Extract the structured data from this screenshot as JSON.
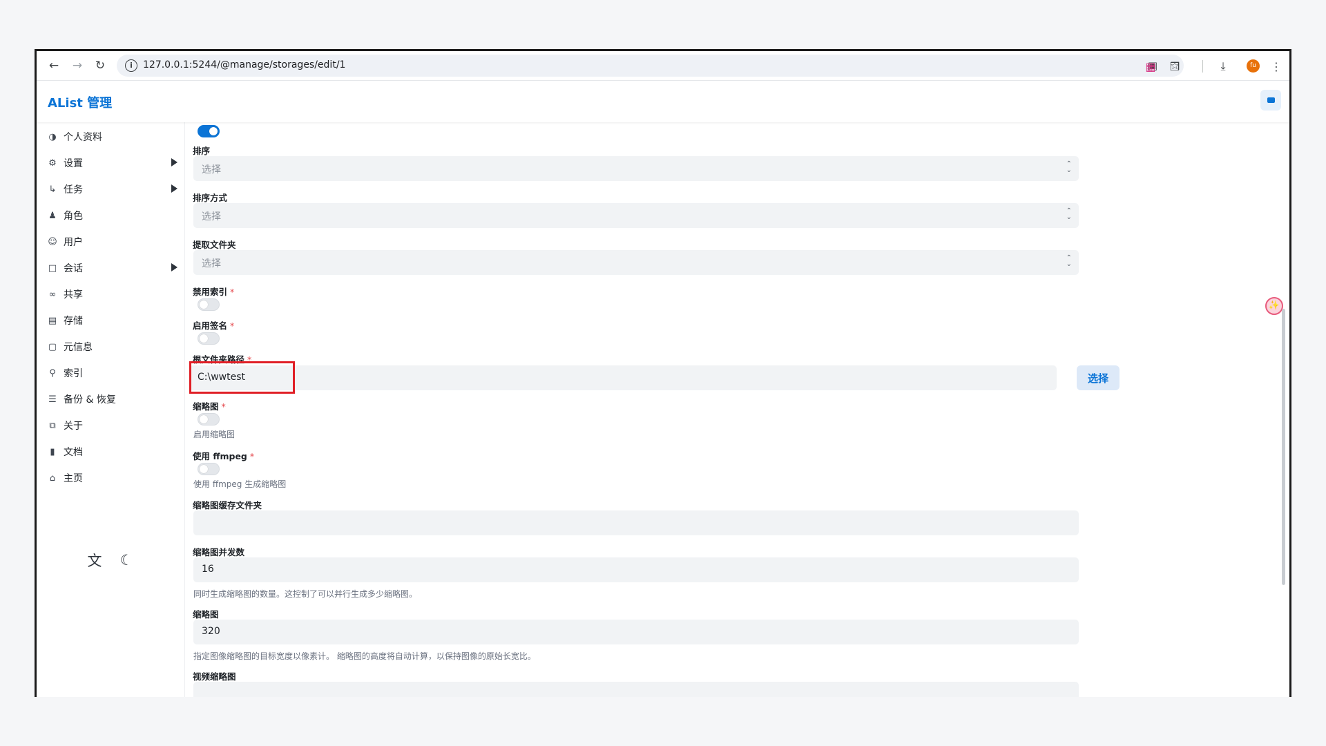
{
  "browser": {
    "url": "127.0.0.1:5244/@manage/storages/edit/1",
    "avatar_text": "fu"
  },
  "app": {
    "brand": "AList 管理"
  },
  "sidebar": {
    "items": [
      {
        "label": "个人资料",
        "icon": "globe-icon",
        "arrow": false
      },
      {
        "label": "设置",
        "icon": "gear-icon",
        "arrow": true
      },
      {
        "label": "任务",
        "icon": "task-flow-icon",
        "arrow": true
      },
      {
        "label": "角色",
        "icon": "role-icon",
        "arrow": false
      },
      {
        "label": "用户",
        "icon": "user-circle-icon",
        "arrow": false
      },
      {
        "label": "会话",
        "icon": "chat-icon",
        "arrow": true
      },
      {
        "label": "共享",
        "icon": "link-icon",
        "arrow": false
      },
      {
        "label": "存储",
        "icon": "storage-icon",
        "arrow": false
      },
      {
        "label": "元信息",
        "icon": "meta-icon",
        "arrow": false
      },
      {
        "label": "索引",
        "icon": "search-icon",
        "arrow": false
      },
      {
        "label": "备份 & 恢复",
        "icon": "database-icon",
        "arrow": false
      },
      {
        "label": "关于",
        "icon": "copy-icon",
        "arrow": false
      },
      {
        "label": "文档",
        "icon": "book-icon",
        "arrow": false
      },
      {
        "label": "主页",
        "icon": "home-icon",
        "arrow": false
      }
    ]
  },
  "form": {
    "sort": {
      "label": "排序",
      "placeholder": "选择"
    },
    "sort_direction": {
      "label": "排序方式",
      "placeholder": "选择"
    },
    "extract_folder": {
      "label": "提取文件夹",
      "placeholder": "选择"
    },
    "disable_index": {
      "label": "禁用索引",
      "required": "*",
      "value": false
    },
    "enable_sign": {
      "label": "启用签名",
      "required": "*",
      "value": false
    },
    "root_folder_path": {
      "label": "根文件夹路径",
      "required": "*",
      "value": "C:\\wwtest",
      "button": "选择"
    },
    "thumbnail": {
      "label": "缩略图",
      "required": "*",
      "help": "启用缩略图",
      "value": false
    },
    "use_ffmpeg": {
      "label": "使用 ffmpeg",
      "required": "*",
      "help": "使用 ffmpeg 生成缩略图",
      "value": false
    },
    "thumb_cache_folder": {
      "label": "缩略图缓存文件夹",
      "value": ""
    },
    "thumb_concurrency": {
      "label": "缩略图并发数",
      "value": "16",
      "help": "同时生成缩略图的数量。这控制了可以并行生成多少缩略图。"
    },
    "thumb_pixel": {
      "label": "缩略图",
      "value": "320",
      "help": "指定图像缩略图的目标宽度以像素计。 缩略图的高度将自动计算，以保持图像的原始长宽比。"
    },
    "video_thumb": {
      "label": "视频缩略图"
    }
  },
  "colors": {
    "accent": "#0b74d6",
    "highlight": "#e01f26",
    "required": "#e5484d"
  }
}
